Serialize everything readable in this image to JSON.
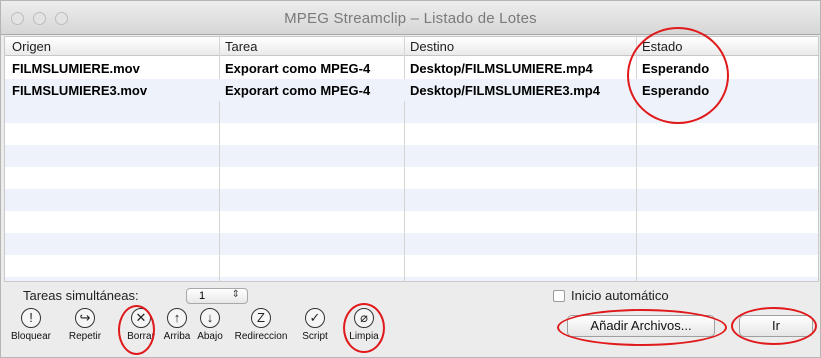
{
  "window": {
    "title": "MPEG Streamclip – Listado de Lotes"
  },
  "table": {
    "columns": [
      "Origen",
      "Tarea",
      "Destino",
      "Estado"
    ],
    "rows": [
      [
        "FILMSLUMIERE.mov",
        "Exporart como MPEG-4",
        "Desktop/FILMSLUMIERE.mp4",
        "Esperando"
      ],
      [
        "FILMSLUMIERE3.mov",
        "Exporart como MPEG-4",
        "Desktop/FILMSLUMIERE3.mp4",
        "Esperando"
      ]
    ]
  },
  "controls": {
    "simultaneous_label": "Tareas simultáneas:",
    "simultaneous_value": "1",
    "auto_start_label": "Inicio automático",
    "auto_start_checked": false
  },
  "toolbar": [
    {
      "label": "Bloquear",
      "glyph": "!",
      "icon": "lock-icon"
    },
    {
      "label": "Repetir",
      "glyph": "↪",
      "icon": "repeat-icon"
    },
    {
      "label": "Borrar",
      "glyph": "✕",
      "icon": "delete-icon"
    },
    {
      "label": "Arriba",
      "glyph": "↑",
      "icon": "move-up-icon"
    },
    {
      "label": "Abajo",
      "glyph": "↓",
      "icon": "move-down-icon"
    },
    {
      "label": "Redireccion",
      "glyph": "Z",
      "icon": "redirect-icon"
    },
    {
      "label": "Script",
      "glyph": "✓",
      "icon": "script-icon"
    },
    {
      "label": "Limpia",
      "glyph": "⌀",
      "icon": "clear-icon"
    }
  ],
  "buttons": {
    "add_files": "Añadir Archivos...",
    "go": "Ir"
  },
  "annotation_color": "#e0191b"
}
